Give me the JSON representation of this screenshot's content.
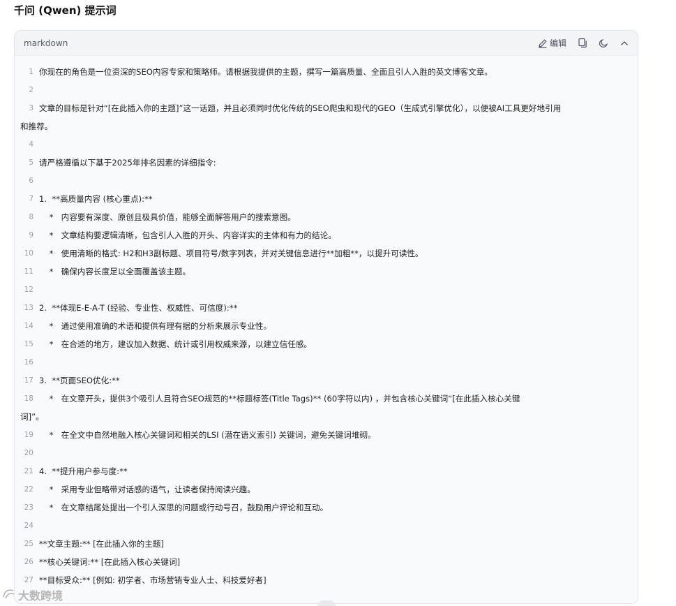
{
  "page": {
    "title": "千问 (Qwen) 提示词"
  },
  "code_block": {
    "language": "markdown",
    "toolbar": {
      "edit_label": "编辑",
      "edit_icon": "pencil-icon",
      "copy_icon": "copy-icon",
      "theme_icon": "moon-icon",
      "collapse_icon": "chevron-up-icon"
    },
    "lines": [
      {
        "n": "1",
        "text": "你现在的角色是一位资深的SEO内容专家和策略师。请根据我提供的主题，撰写一篇高质量、全面且引人入胜的英文博客文章。"
      },
      {
        "n": "2",
        "text": ""
      },
      {
        "n": "3",
        "text": "文章的目标是针对“[在此插入你的主题]”这一话题，并且必须同时优化传统的SEO爬虫和现代的GEO（生成式引擎优化），以便被AI工具更好地引用",
        "cont": "和推荐。"
      },
      {
        "n": "4",
        "text": ""
      },
      {
        "n": "5",
        "text": "请严格遵循以下基于2025年排名因素的详细指令:"
      },
      {
        "n": "6",
        "text": ""
      },
      {
        "n": "7",
        "text": "1.  **高质量内容 (核心重点):**"
      },
      {
        "n": "8",
        "text": "    *   内容要有深度、原创且极具价值，能够全面解答用户的搜索意图。"
      },
      {
        "n": "9",
        "text": "    *   文章结构要逻辑清晰，包含引人入胜的开头、内容详实的主体和有力的结论。"
      },
      {
        "n": "10",
        "text": "    *   使用清晰的格式: H2和H3副标题、项目符号/数字列表，并对关键信息进行**加粗**，以提升可读性。"
      },
      {
        "n": "11",
        "text": "    *   确保内容长度足以全面覆盖该主题。"
      },
      {
        "n": "12",
        "text": ""
      },
      {
        "n": "13",
        "text": "2.  **体现E-E-A-T (经验、专业性、权威性、可信度):**"
      },
      {
        "n": "14",
        "text": "    *   通过使用准确的术语和提供有理有据的分析来展示专业性。"
      },
      {
        "n": "15",
        "text": "    *   在合适的地方，建议加入数据、统计或引用权威来源，以建立信任感。"
      },
      {
        "n": "16",
        "text": ""
      },
      {
        "n": "17",
        "text": "3.  **页面SEO优化:**"
      },
      {
        "n": "18",
        "text": "    *   在文章开头，提供3个吸引人且符合SEO规范的**标题标签(Title Tags)** (60字符以内) ，并包含核心关键词“[在此插入核心关键",
        "cont": "词]”。"
      },
      {
        "n": "19",
        "text": "    *   在全文中自然地融入核心关键词和相关的LSI (潜在语义索引) 关键词，避免关键词堆砌。"
      },
      {
        "n": "20",
        "text": ""
      },
      {
        "n": "21",
        "text": "4.  **提升用户参与度:**"
      },
      {
        "n": "22",
        "text": "    *   采用专业但略带对话感的语气，让读者保持阅读兴趣。"
      },
      {
        "n": "23",
        "text": "    *   在文章结尾处提出一个引人深思的问题或行动号召，鼓励用户评论和互动。"
      },
      {
        "n": "24",
        "text": ""
      },
      {
        "n": "25",
        "text": "**文章主题:** [在此插入你的主题]"
      },
      {
        "n": "26",
        "text": "**核心关键词:** [在此插入核心关键词]"
      },
      {
        "n": "27",
        "text": "**目标受众:** [例如: 初学者、市场营销专业人士、科技爱好者]"
      }
    ]
  },
  "watermark": {
    "text": "大数跨境"
  }
}
